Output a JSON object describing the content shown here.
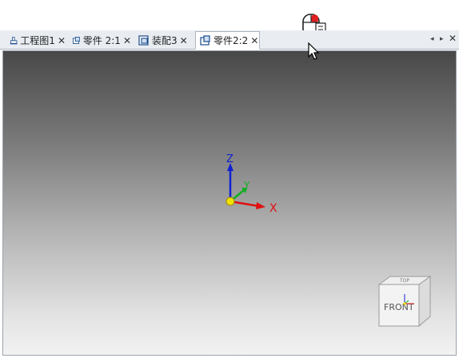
{
  "tabs": [
    {
      "label": "工程图1",
      "icon": "drawing-icon",
      "active": false
    },
    {
      "label": "零件 2:1",
      "icon": "part-icon",
      "active": false
    },
    {
      "label": "装配3",
      "icon": "assembly-icon",
      "active": false
    },
    {
      "label": "零件2:2",
      "icon": "part-icon",
      "active": true
    }
  ],
  "tab_close_glyph": "✕",
  "tab_controls": {
    "prev": "◂",
    "next": "▸",
    "close": "✕"
  },
  "viewport": {
    "axes": {
      "x": "X",
      "y": "Y",
      "z": "Z"
    },
    "viewcube": {
      "face_label": "FRONT",
      "top_label": "TOP"
    }
  },
  "colors": {
    "x_axis": "#e01010",
    "y_axis": "#10b020",
    "z_axis": "#1020d0",
    "origin": "#f0e000",
    "tab_bar": "#e9edf2"
  }
}
